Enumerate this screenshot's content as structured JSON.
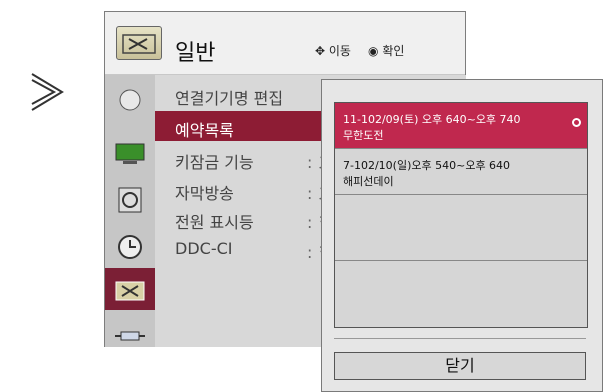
{
  "header": {
    "icon": "toolbox-icon",
    "title": "일반",
    "move_label": "이동",
    "ok_label": "확인"
  },
  "categories": [
    {
      "icon": "satellite-dish-icon"
    },
    {
      "icon": "monitor-icon"
    },
    {
      "icon": "speaker-icon"
    },
    {
      "icon": "clock-icon"
    },
    {
      "icon": "toolbox-icon",
      "selected": true
    },
    {
      "icon": "cable-icon"
    }
  ],
  "items": [
    {
      "label": "연결기기명 편집",
      "value": ""
    },
    {
      "label": "예약목록",
      "value": "",
      "selected": true
    },
    {
      "label": "키잠금 기능",
      "value": ": ス"
    },
    {
      "label": "자막방송",
      "value": ": ス"
    },
    {
      "label": "전원 표시등",
      "value": ": ヲ"
    },
    {
      "label": "DDC-CI",
      "value": ": ヲ"
    }
  ],
  "popup": {
    "rows": [
      {
        "line1": "11-102/09(토) 오후 640~오후 740",
        "line2": "무한도전",
        "selected": true
      },
      {
        "line1": "7-102/10(일)오후 540~오후 640",
        "line2": "해피선데이"
      },
      {
        "line1": "",
        "line2": ""
      },
      {
        "line1": "",
        "line2": ""
      }
    ],
    "close_label": "닫기"
  },
  "colors": {
    "selected_item": "#8d1c34",
    "selected_row": "#c0284e"
  }
}
